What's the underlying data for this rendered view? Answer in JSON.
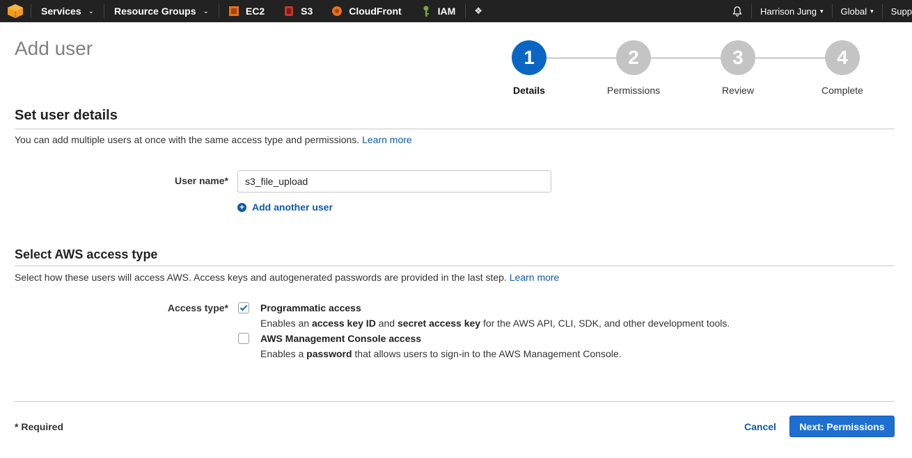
{
  "nav": {
    "services_label": "Services",
    "resource_groups_label": "Resource Groups",
    "shortcuts": [
      {
        "label": "EC2",
        "icon": "ec2-icon",
        "color": "#e8701a"
      },
      {
        "label": "S3",
        "icon": "s3-icon",
        "color": "#c7352c"
      },
      {
        "label": "CloudFront",
        "icon": "cloudfront-icon",
        "color": "#e8701a"
      },
      {
        "label": "IAM",
        "icon": "iam-key-icon",
        "color": "#7aa83b"
      }
    ],
    "user_label": "Harrison Jung",
    "region_label": "Global",
    "support_label": "Supp"
  },
  "page": {
    "title": "Add user"
  },
  "stepper": {
    "steps": [
      {
        "number": "1",
        "label": "Details",
        "active": true
      },
      {
        "number": "2",
        "label": "Permissions",
        "active": false
      },
      {
        "number": "3",
        "label": "Review",
        "active": false
      },
      {
        "number": "4",
        "label": "Complete",
        "active": false
      }
    ]
  },
  "user_details": {
    "title": "Set user details",
    "description": "You can add multiple users at once with the same access type and permissions.",
    "learn_more": "Learn more",
    "user_name_label": "User name*",
    "user_name_value": "s3_file_upload",
    "add_another_label": "Add another user"
  },
  "access_type": {
    "title": "Select AWS access type",
    "description": "Select how these users will access AWS. Access keys and autogenerated passwords are provided in the last step.",
    "learn_more": "Learn more",
    "label": "Access type*",
    "options": [
      {
        "title": "Programmatic access",
        "checked": true,
        "desc_parts": [
          "Enables an ",
          "access key ID",
          " and ",
          "secret access key",
          " for the AWS API, CLI, SDK, and other development tools."
        ]
      },
      {
        "title": "AWS Management Console access",
        "checked": false,
        "desc_parts": [
          "Enables a ",
          "password",
          " that allows users to sign-in to the AWS Management Console."
        ]
      }
    ]
  },
  "footer": {
    "required_label": "* Required",
    "cancel_label": "Cancel",
    "next_label": "Next: Permissions"
  },
  "colors": {
    "primary": "#0a66c2",
    "link": "#0e5aa7",
    "nav_bg": "#222222",
    "step_inactive": "#c4c4c4"
  }
}
